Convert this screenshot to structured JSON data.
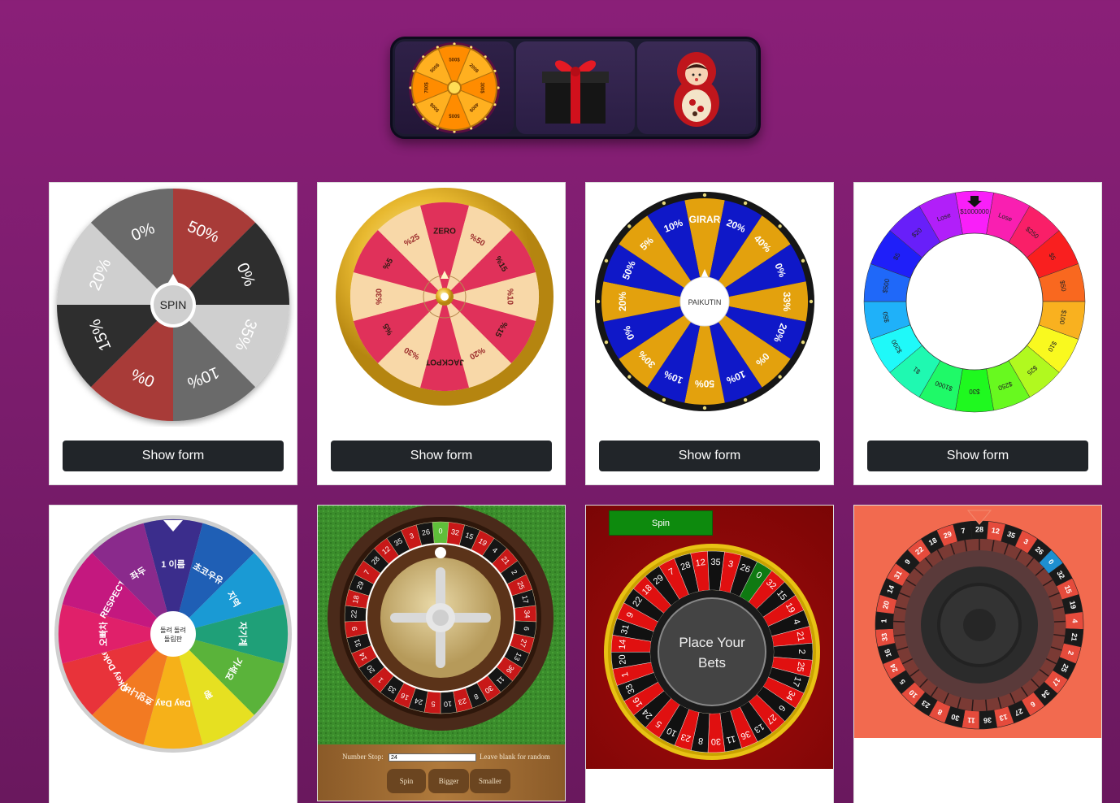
{
  "tabs": [
    {
      "icon": "spin-wheel-icon"
    },
    {
      "icon": "gift-box-icon"
    },
    {
      "icon": "matryoshka-doll-icon"
    }
  ],
  "tab_wheel_labels": [
    "500$",
    "200$",
    "300$",
    "400$",
    "500$",
    "500$",
    "700$",
    "500$"
  ],
  "card1": {
    "center_label": "SPIN",
    "segments": [
      "50%",
      "0%",
      "35%",
      "10%",
      "0%",
      "15%",
      "20%",
      "0%"
    ],
    "button": "Show form"
  },
  "card2": {
    "labels": [
      "ZERO",
      "%50",
      "%15",
      "%10",
      "%15",
      "%20",
      "JACKPOT",
      "%30",
      "%5",
      "%30",
      "%5",
      "%25"
    ],
    "button": "Show form"
  },
  "card3": {
    "center_label": "PAIKUTIN",
    "labels": [
      "GIRAR",
      "20%",
      "40%",
      "0%",
      "33%",
      "20%",
      "0%",
      "10%",
      "50%",
      "10%",
      "30%",
      "0%",
      "20%",
      "50%",
      "5%",
      "10%"
    ],
    "button": "Show form"
  },
  "card4": {
    "labels": [
      "$1000000",
      "Lose",
      "$250",
      "$5",
      "$50",
      "$100",
      "$10",
      "$25",
      "$250",
      "$30",
      "$1000",
      "$1",
      "$200",
      "$50",
      "$500",
      "$5",
      "$20",
      "Lose"
    ],
    "button": "Show form"
  },
  "card5": {
    "center_label": "돌려 돌려 돌림판",
    "labels": [
      "1 이름",
      "초코우유",
      "지역",
      "자기계",
      "가세요",
      "꽝",
      "Day Day",
      "흐앙나비",
      "Okey Dokey",
      "오빠차",
      "RESPECT",
      "좌두"
    ]
  },
  "card6": {
    "numbers": [
      "0",
      "32",
      "15",
      "19",
      "4",
      "21",
      "2",
      "25",
      "17",
      "34",
      "6",
      "27",
      "13",
      "36",
      "11",
      "30",
      "8",
      "23",
      "10",
      "5",
      "24",
      "16",
      "33",
      "1",
      "20",
      "14",
      "31",
      "9",
      "22",
      "18",
      "29",
      "7",
      "28",
      "12",
      "35",
      "3",
      "26"
    ],
    "form_label": "Number Stop:",
    "form_value": "24",
    "form_hint": "Leave blank for random",
    "buttons": [
      "Spin",
      "Bigger",
      "Smaller"
    ]
  },
  "card7": {
    "spin_button": "Spin",
    "center_text_1": "Place Your",
    "center_text_2": "Bets",
    "numbers": [
      "0",
      "32",
      "15",
      "19",
      "4",
      "21",
      "2",
      "25",
      "17",
      "34",
      "6",
      "27",
      "13",
      "36",
      "11",
      "30",
      "8",
      "23",
      "10",
      "5",
      "24",
      "16",
      "33",
      "1",
      "20",
      "14",
      "31",
      "9",
      "22",
      "18",
      "29",
      "7",
      "28",
      "12",
      "35",
      "3",
      "26"
    ]
  },
  "card8": {
    "numbers": [
      "28",
      "12",
      "35",
      "3",
      "26",
      "0",
      "32",
      "15",
      "19",
      "4",
      "21",
      "2",
      "25",
      "17",
      "34",
      "6",
      "27",
      "13",
      "36",
      "11",
      "30",
      "8",
      "23",
      "10",
      "5",
      "24",
      "16",
      "33",
      "1",
      "20",
      "14",
      "31",
      "9",
      "22",
      "18",
      "29",
      "7"
    ]
  },
  "colors": {
    "background": "#7e1d70",
    "button": "#212529"
  }
}
